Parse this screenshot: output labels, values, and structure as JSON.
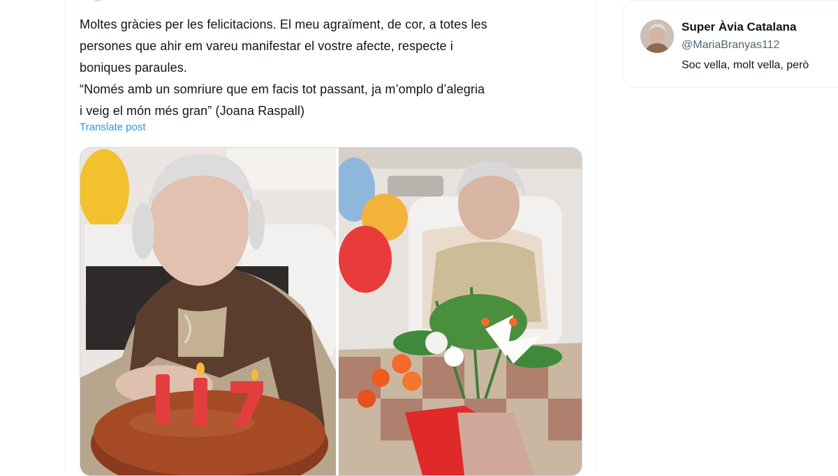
{
  "post": {
    "text_lines": [
      "Moltes gràcies per les felicitacions. El meu agraïment, de cor, a totes les",
      "persones que ahir em vareu manifestar el vostre afecte, respecte i",
      "boniques paraules.",
      "“Només amb un somriure que em facis tot passant, ja m’omplo d’alegria",
      "i veig el món més gran” (Joana Raspall)"
    ],
    "translate_label": "Translate post",
    "images": [
      {
        "icon": "photo-birthday-cake-117"
      },
      {
        "icon": "photo-bouquet-balloons"
      }
    ],
    "candle_number": "117"
  },
  "sidebar": {
    "profile": {
      "name": "Super Àvia Catalana",
      "handle": "@MariaBranyas112",
      "bio": "Soc vella, molt vella, però"
    }
  },
  "colors": {
    "link": "#1d9bf0",
    "text": "#0f1419",
    "secondary": "#536471",
    "border": "#cfd9de"
  }
}
